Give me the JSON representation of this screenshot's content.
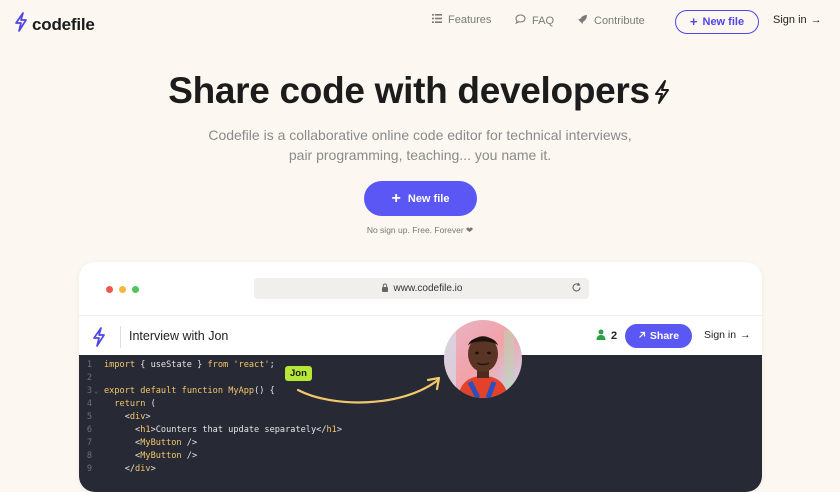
{
  "nav": {
    "brand": "codefile",
    "links": [
      {
        "label": "Features",
        "icon": "list-icon"
      },
      {
        "label": "FAQ",
        "icon": "chat-bubble-icon"
      },
      {
        "label": "Contribute",
        "icon": "rocket-icon"
      }
    ],
    "new_file": "New file",
    "sign_in": "Sign in"
  },
  "hero": {
    "title": "Share code with developers",
    "subtitle": "Codefile is a collaborative online code editor for technical interviews, pair programming, teaching... you name it.",
    "cta": "New file",
    "note": "No sign up. Free. Forever ❤"
  },
  "browser": {
    "url": "www.codefile.io",
    "app_title": "Interview with Jon",
    "user_count": "2",
    "share": "Share",
    "sign_in": "Sign in"
  },
  "cursor": {
    "user": "Jon"
  },
  "code": {
    "lines": [
      {
        "n": "1",
        "fold": false,
        "parts": [
          [
            "kw",
            "import"
          ],
          [
            "p",
            " { useState } "
          ],
          [
            "kw",
            "from"
          ],
          [
            "p",
            " "
          ],
          [
            "str",
            "'react'"
          ],
          [
            "p",
            ";"
          ]
        ]
      },
      {
        "n": "2",
        "fold": false,
        "parts": [
          [
            "p",
            ""
          ]
        ]
      },
      {
        "n": "3",
        "fold": true,
        "parts": [
          [
            "kw",
            "export"
          ],
          [
            "p",
            " "
          ],
          [
            "kw",
            "default"
          ],
          [
            "p",
            " "
          ],
          [
            "kw",
            "function"
          ],
          [
            "p",
            " "
          ],
          [
            "fn",
            "MyApp"
          ],
          [
            "p",
            "() {"
          ]
        ]
      },
      {
        "n": "4",
        "fold": false,
        "parts": [
          [
            "p",
            "  "
          ],
          [
            "kw",
            "return"
          ],
          [
            "p",
            " ("
          ]
        ]
      },
      {
        "n": "5",
        "fold": false,
        "parts": [
          [
            "p",
            "    <"
          ],
          [
            "tag",
            "div"
          ],
          [
            "p",
            ">"
          ]
        ]
      },
      {
        "n": "6",
        "fold": false,
        "parts": [
          [
            "p",
            "      <"
          ],
          [
            "tag",
            "h1"
          ],
          [
            "p",
            ">Counters that update separately</"
          ],
          [
            "tag",
            "h1"
          ],
          [
            "p",
            ">"
          ]
        ]
      },
      {
        "n": "7",
        "fold": false,
        "parts": [
          [
            "p",
            "      <"
          ],
          [
            "tag",
            "MyButton"
          ],
          [
            "p",
            " />"
          ]
        ]
      },
      {
        "n": "8",
        "fold": false,
        "parts": [
          [
            "p",
            "      <"
          ],
          [
            "tag",
            "MyButton"
          ],
          [
            "p",
            " />"
          ]
        ]
      },
      {
        "n": "9",
        "fold": false,
        "parts": [
          [
            "p",
            "    </"
          ],
          [
            "tag",
            "div"
          ],
          [
            "p",
            ">"
          ]
        ]
      }
    ]
  },
  "colors": {
    "accent": "#5b57f5",
    "background": "#fcf8f1",
    "editor": "#272935",
    "cursor_label": "#b6e636",
    "arrow": "#f3c86b"
  }
}
